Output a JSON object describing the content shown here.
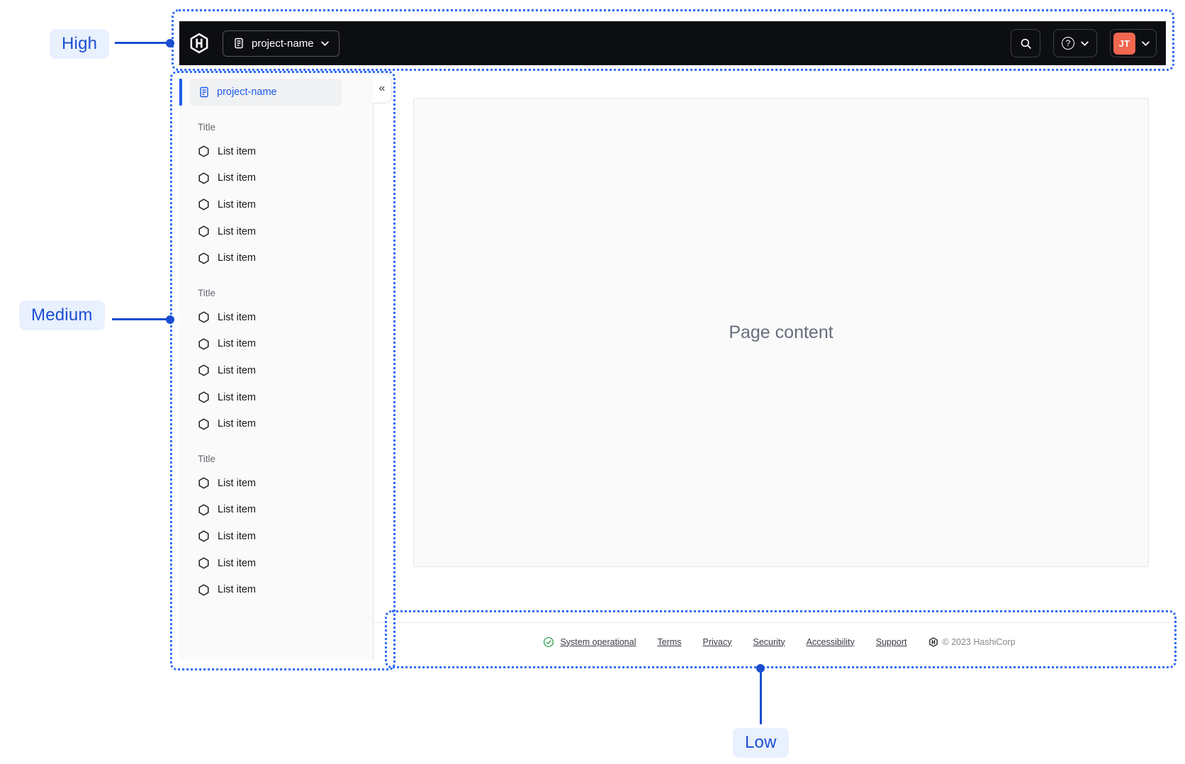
{
  "annotations": {
    "high_label": "High",
    "medium_label": "Medium",
    "low_label": "Low"
  },
  "navbar": {
    "project_selector_label": "project-name",
    "help_glyph": "?",
    "account_initials": "JT",
    "icons": [
      "hashicorp-logo-icon",
      "document-icon",
      "chevron-down-icon",
      "search-icon",
      "help-icon"
    ]
  },
  "sidebar": {
    "active_item_label": "project-name",
    "collapse_glyph": "«",
    "sections": [
      {
        "title": "Title",
        "items": [
          "List item",
          "List item",
          "List item",
          "List item",
          "List item"
        ]
      },
      {
        "title": "Title",
        "items": [
          "List item",
          "List item",
          "List item",
          "List item",
          "List item"
        ]
      },
      {
        "title": "Title",
        "items": [
          "List item",
          "List item",
          "List item",
          "List item",
          "List item"
        ]
      }
    ]
  },
  "main": {
    "placeholder": "Page content"
  },
  "footer": {
    "status_label": "System operational",
    "links": [
      "Terms",
      "Privacy",
      "Security",
      "Accessibility",
      "Support"
    ],
    "copyright": "© 2023 HashiCorp"
  },
  "colors": {
    "navbar_bg": "#0D0E12",
    "accent_blue": "#1C5BE8",
    "annotation_blue": "#2E6BF5",
    "annotation_label_blue": "#1B4FD1",
    "annotation_pill_bg": "#E9F0FE",
    "avatar_orange": "#F1674F",
    "status_green": "#2E9E4F",
    "sidebar_bg": "#FAFAFA",
    "muted_text": "#65696F"
  }
}
